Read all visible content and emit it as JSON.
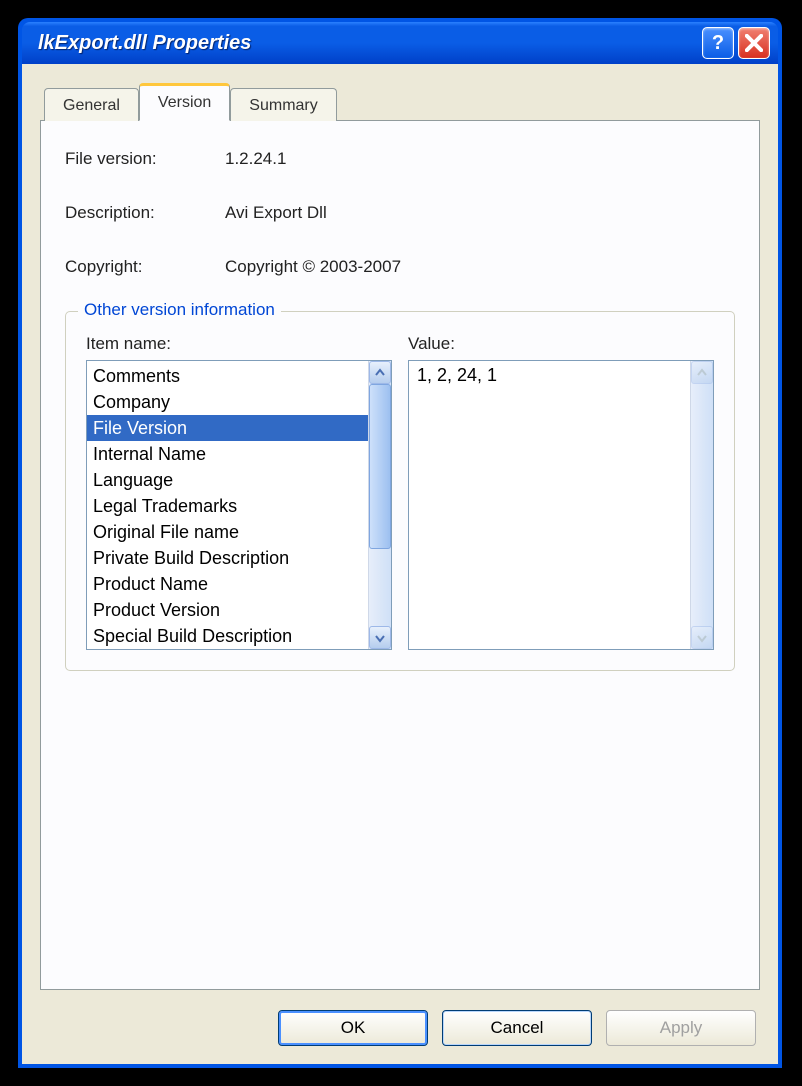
{
  "window": {
    "title": "lkExport.dll Properties"
  },
  "tabs": [
    {
      "label": "General"
    },
    {
      "label": "Version"
    },
    {
      "label": "Summary"
    }
  ],
  "info": {
    "file_version_label": "File version:",
    "file_version_value": "1.2.24.1",
    "description_label": "Description:",
    "description_value": "Avi Export Dll",
    "copyright_label": "Copyright:",
    "copyright_value": "Copyright © 2003-2007"
  },
  "group": {
    "legend": "Other version information",
    "item_name_label": "Item name:",
    "value_label": "Value:",
    "items": [
      "Comments",
      "Company",
      "File Version",
      "Internal Name",
      "Language",
      "Legal Trademarks",
      "Original File name",
      "Private Build Description",
      "Product Name",
      "Product Version",
      "Special Build Description"
    ],
    "selected_index": 2,
    "value_text": "1, 2, 24, 1"
  },
  "buttons": {
    "ok": "OK",
    "cancel": "Cancel",
    "apply": "Apply"
  }
}
